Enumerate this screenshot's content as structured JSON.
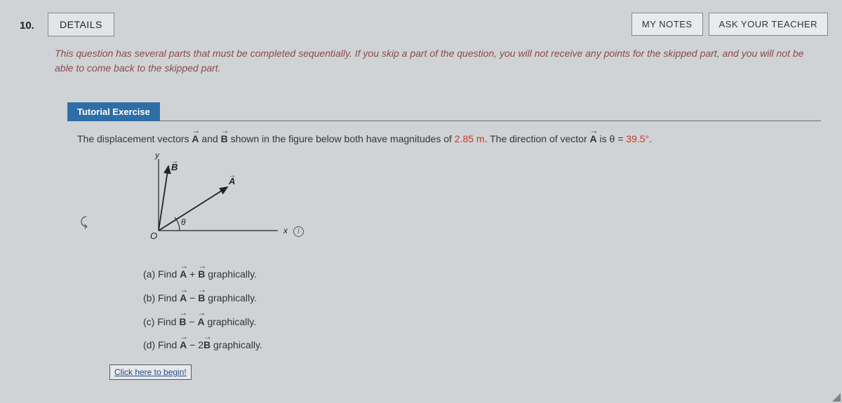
{
  "header": {
    "qnum": "10.",
    "details": "DETAILS",
    "my_notes": "MY NOTES",
    "ask_teacher": "ASK YOUR TEACHER"
  },
  "warning": "This question has several parts that must be completed sequentially. If you skip a part of the question, you will not receive any points for the skipped part, and you will not be able to come back to the skipped part.",
  "tutorial_label": "Tutorial Exercise",
  "problem": {
    "pre": "The displacement vectors ",
    "vecA": "A",
    "mid1": " and ",
    "vecB": "B",
    "mid2": " shown in the figure below both have magnitudes of ",
    "mag": "2.85 m",
    "mid3": ". The direction of vector ",
    "vecA2": "A",
    "mid4": " is θ = ",
    "angle": "39.5°",
    "end": "."
  },
  "figure": {
    "y": "y",
    "x": "x",
    "origin": "O",
    "theta": "θ",
    "A": "A",
    "B": "B"
  },
  "info_icon": "i",
  "parts": {
    "a_pre": "(a) Find ",
    "a_op": " + ",
    "a_post": " graphically.",
    "b_pre": "(b) Find ",
    "b_op": " − ",
    "b_post": " graphically.",
    "c_pre": "(c) Find ",
    "c_op": " − ",
    "c_post": " graphically.",
    "d_pre": "(d) Find ",
    "d_op": " − 2",
    "d_post": " graphically."
  },
  "begin": "Click here to begin!"
}
